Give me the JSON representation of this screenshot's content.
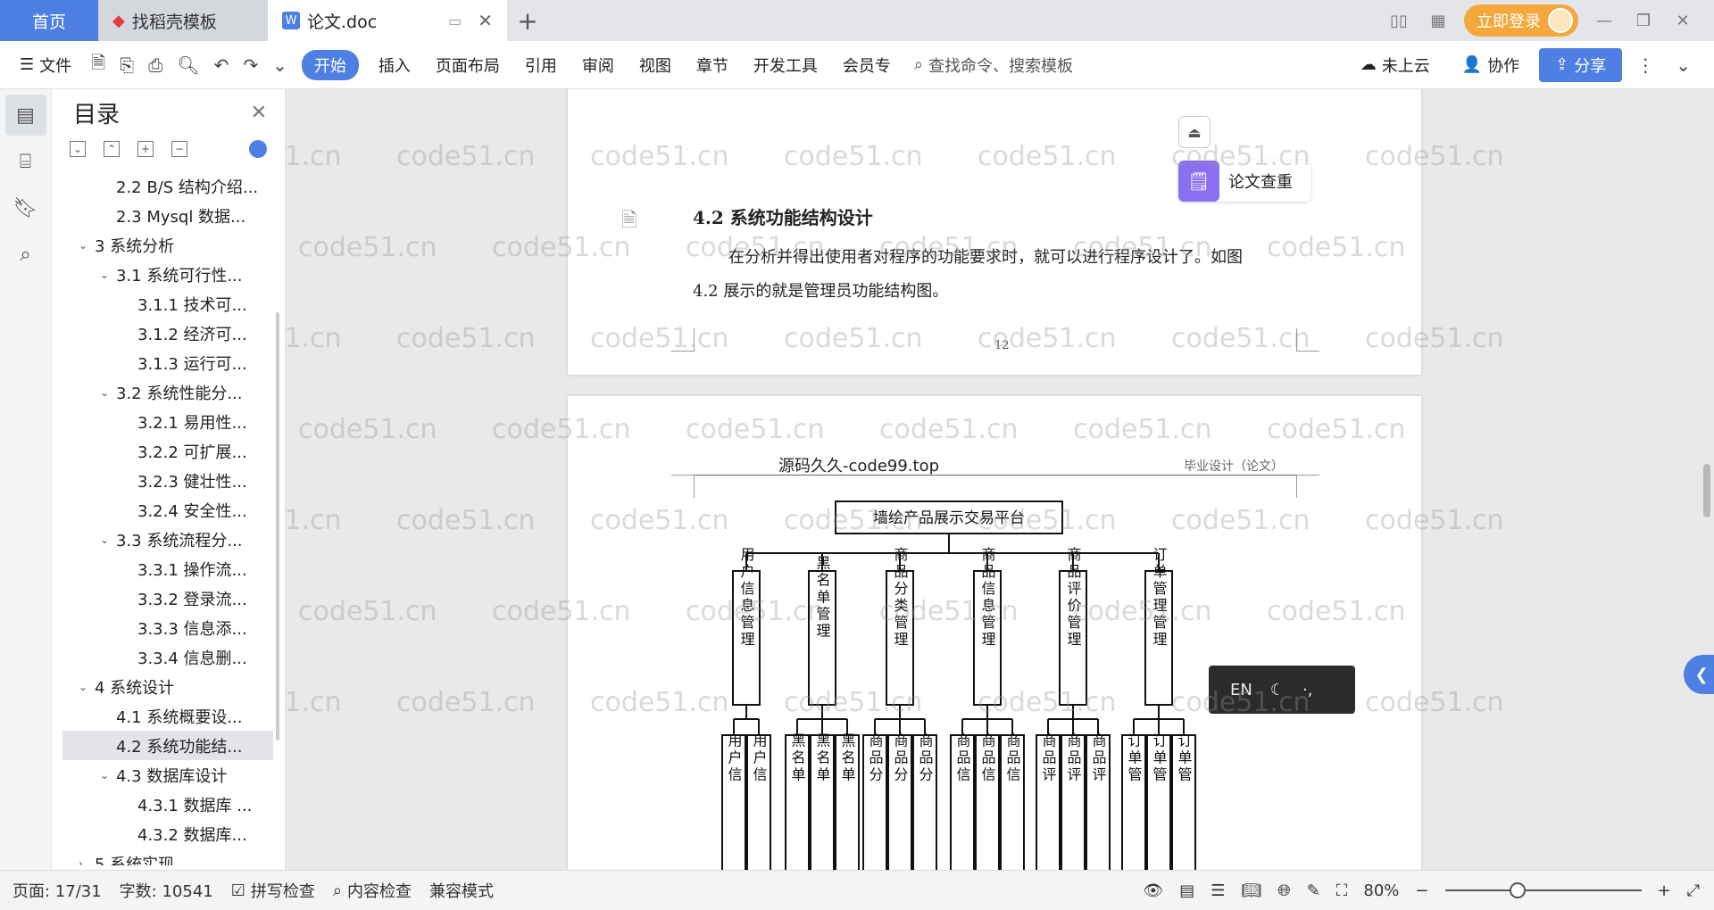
{
  "tabs": {
    "home": "首页",
    "template": "找稻壳模板",
    "document": "论文.doc",
    "add": "+"
  },
  "titlebar": {
    "login": "立即登录"
  },
  "toolbar": {
    "file": "文件",
    "menus": [
      "开始",
      "插入",
      "页面布局",
      "引用",
      "审阅",
      "视图",
      "章节",
      "开发工具",
      "会员专"
    ],
    "search_placeholder": "查找命令、搜索模板",
    "cloud": "未上云",
    "collab": "协作",
    "share": "分享"
  },
  "toc": {
    "title": "目录",
    "items": [
      {
        "level": 2,
        "caret": "",
        "label": "2.2 B/S 结构介绍..."
      },
      {
        "level": 2,
        "caret": "",
        "label": "2.3 Mysql 数据..."
      },
      {
        "level": 1,
        "caret": "v",
        "label": "3  系统分析"
      },
      {
        "level": 2,
        "caret": "v",
        "label": "3.1  系统可行性..."
      },
      {
        "level": 3,
        "caret": "",
        "label": "3.1.1  技术可..."
      },
      {
        "level": 3,
        "caret": "",
        "label": "3.1.2  经济可..."
      },
      {
        "level": 3,
        "caret": "",
        "label": "3.1.3  运行可..."
      },
      {
        "level": 2,
        "caret": "v",
        "label": "3.2  系统性能分..."
      },
      {
        "level": 3,
        "caret": "",
        "label": "3.2.1  易用性..."
      },
      {
        "level": 3,
        "caret": "",
        "label": "3.2.2  可扩展..."
      },
      {
        "level": 3,
        "caret": "",
        "label": "3.2.3  健壮性..."
      },
      {
        "level": 3,
        "caret": "",
        "label": "3.2.4  安全性..."
      },
      {
        "level": 2,
        "caret": "v",
        "label": "3.3  系统流程分..."
      },
      {
        "level": 3,
        "caret": "",
        "label": "3.3.1  操作流..."
      },
      {
        "level": 3,
        "caret": "",
        "label": "3.3.2  登录流..."
      },
      {
        "level": 3,
        "caret": "",
        "label": "3.3.3  信息添..."
      },
      {
        "level": 3,
        "caret": "",
        "label": "3.3.4  信息删..."
      },
      {
        "level": 1,
        "caret": "v",
        "label": "4  系统设计"
      },
      {
        "level": 2,
        "caret": "",
        "label": "4.1  系统概要设..."
      },
      {
        "level": 2,
        "caret": "",
        "label": "4.2  系统功能结...",
        "selected": true
      },
      {
        "level": 2,
        "caret": "v",
        "label": "4.3  数据库设计"
      },
      {
        "level": 3,
        "caret": "",
        "label": "4.3.1  数据库 ..."
      },
      {
        "level": 3,
        "caret": "",
        "label": "4.3.2  数据库..."
      },
      {
        "level": 1,
        "caret": ">",
        "label": "5  系统实现"
      }
    ]
  },
  "document": {
    "heading": "4.2  系统功能结构设计",
    "para_line1": "在分析并得出使用者对程序的功能要求时，就可以进行程序设计了。如图",
    "para_line2": "4.2 展示的就是管理员功能结构图。",
    "page_number": "12",
    "header_left": "源码久久-code99.top",
    "header_right": "毕业设计（论文）",
    "chart_root": "墙绘产品展示交易平台",
    "chart_modules": [
      "用户信息管理",
      "黑名单管理",
      "商品分类管理",
      "商品信息管理",
      "商品评价管理",
      "订单管理管理"
    ],
    "chart_leaf_prefixes": [
      "用户信",
      "黑名单",
      "商品分",
      "商品信",
      "商品评",
      "订单管"
    ]
  },
  "watermark": "code51.cn",
  "right_panel": {
    "check": "论文查重",
    "ime_lang": "EN"
  },
  "status": {
    "page": "页面: 17/31",
    "words": "字数: 10541",
    "spell": "拼写检查",
    "content": "内容检查",
    "compat": "兼容模式",
    "zoom": "80%"
  }
}
